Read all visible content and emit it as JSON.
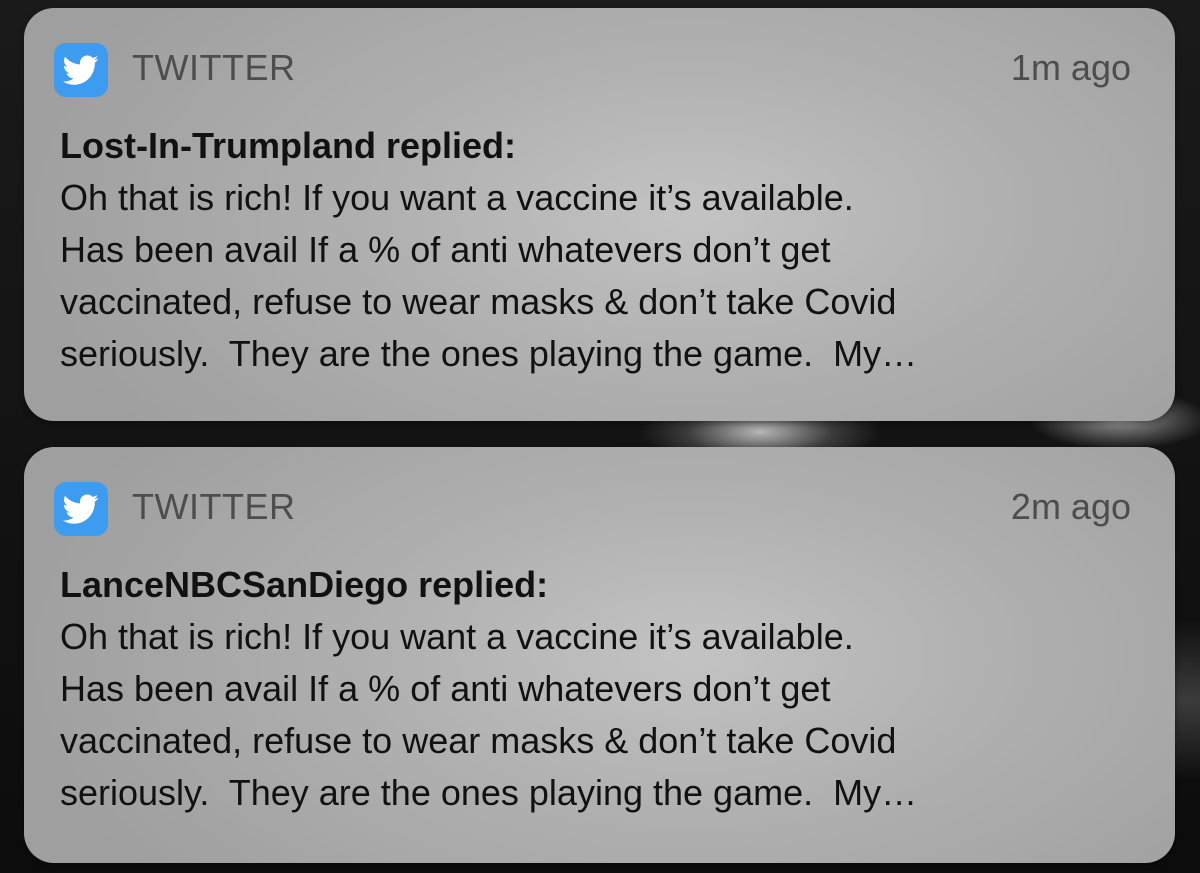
{
  "notifications": [
    {
      "app_name": "TWITTER",
      "app_icon": "twitter-bird-icon",
      "time": "1m ago",
      "title": "Lost-In-Trumpland replied:",
      "lines": [
        "Oh that is rich! If you want a vaccine it’s available.",
        "Has been avail If a % of anti whatevers don’t get",
        "vaccinated, refuse to wear masks & don’t take Covid",
        "seriously.  They are the ones playing the game.  My…"
      ]
    },
    {
      "app_name": "TWITTER",
      "app_icon": "twitter-bird-icon",
      "time": "2m ago",
      "title": "LanceNBCSanDiego replied:",
      "lines": [
        "Oh that is rich! If you want a vaccine it’s available.",
        "Has been avail If a % of anti whatevers don’t get",
        "vaccinated, refuse to wear masks & don’t take Covid",
        "seriously.  They are the ones playing the game.  My…"
      ]
    }
  ],
  "colors": {
    "twitter_blue": "#3d9cf0",
    "card_bg": "#b5b5b5",
    "secondary_text": "#4d4d4d",
    "primary_text": "#111111"
  }
}
